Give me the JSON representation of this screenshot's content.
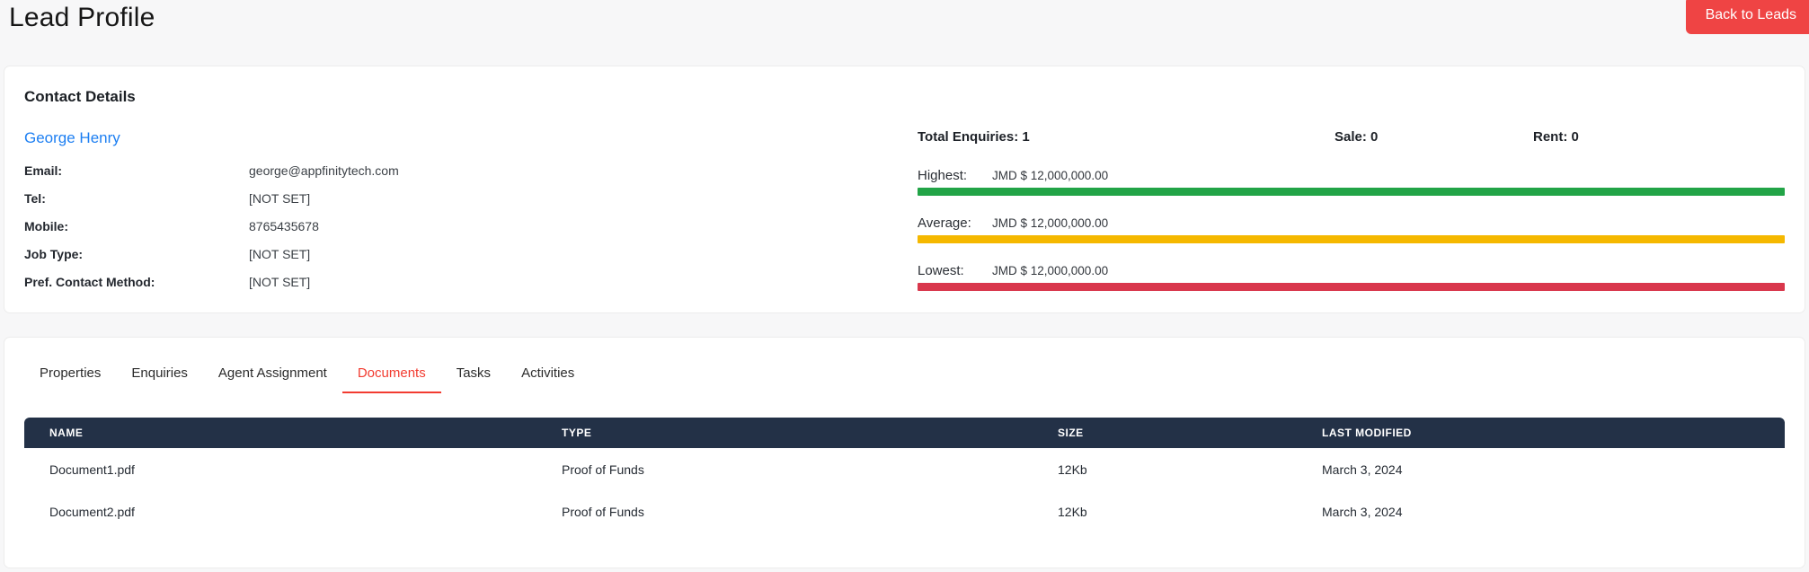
{
  "page": {
    "title": "Lead Profile"
  },
  "header": {
    "back_button_label": "Back to Leads",
    "back_button_color": "#ef4444"
  },
  "contact": {
    "section_title": "Contact Details",
    "name": "George Henry",
    "name_color": "#1d7ff2",
    "fields": [
      {
        "label": "Email:",
        "value": "george@appfinitytech.com"
      },
      {
        "label": "Tel:",
        "value": "[NOT SET]"
      },
      {
        "label": "Mobile:",
        "value": "8765435678"
      },
      {
        "label": "Job Type:",
        "value": "[NOT SET]"
      },
      {
        "label": "Pref. Contact Method:",
        "value": "[NOT SET]"
      }
    ]
  },
  "enquiry_summary": {
    "stats": [
      {
        "label": "Total Enquiries:",
        "value": "1"
      },
      {
        "label": "Sale:",
        "value": "0"
      },
      {
        "label": "Rent:",
        "value": "0"
      }
    ],
    "bars": [
      {
        "label": "Highest:",
        "value": "JMD $ 12,000,000.00",
        "color": "#22a447"
      },
      {
        "label": "Average:",
        "value": "JMD $ 12,000,000.00",
        "color": "#f5b800"
      },
      {
        "label": "Lowest:",
        "value": "JMD $ 12,000,000.00",
        "color": "#d9374c"
      }
    ]
  },
  "tabs": {
    "active": "Documents",
    "active_color": "#f23b30",
    "items": [
      {
        "label": "Properties"
      },
      {
        "label": "Enquiries"
      },
      {
        "label": "Agent Assignment"
      },
      {
        "label": "Documents"
      },
      {
        "label": "Tasks"
      },
      {
        "label": "Activities"
      }
    ]
  },
  "documents_table": {
    "header_color": "#233147",
    "columns": [
      "NAME",
      "TYPE",
      "SIZE",
      "LAST MODIFIED"
    ],
    "rows": [
      {
        "name": "Document1.pdf",
        "type": "Proof of Funds",
        "size": "12Kb",
        "last_modified": "March 3, 2024"
      },
      {
        "name": "Document2.pdf",
        "type": "Proof of Funds",
        "size": "12Kb",
        "last_modified": "March 3, 2024"
      }
    ]
  }
}
